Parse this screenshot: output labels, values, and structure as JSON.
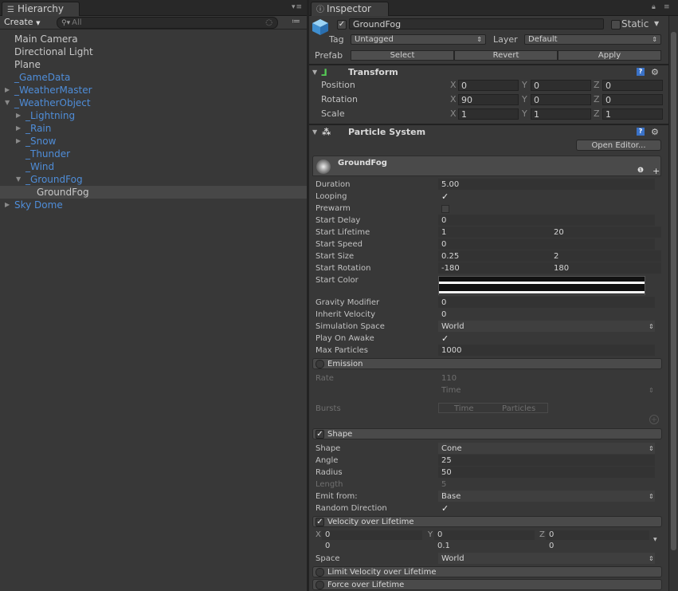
{
  "hierarchy": {
    "tab_label": "Hierarchy",
    "create_label": "Create",
    "search_placeholder": "All",
    "items": [
      {
        "label": "Main Camera"
      },
      {
        "label": "Directional Light"
      },
      {
        "label": "Plane"
      },
      {
        "label": "_GameData"
      },
      {
        "label": "_WeatherMaster"
      },
      {
        "label": "_WeatherObject"
      },
      {
        "label": "_Lightning"
      },
      {
        "label": "_Rain"
      },
      {
        "label": "_Snow"
      },
      {
        "label": "_Thunder"
      },
      {
        "label": "_Wind"
      },
      {
        "label": "_GroundFog"
      },
      {
        "label": "GroundFog"
      },
      {
        "label": "Sky Dome"
      }
    ]
  },
  "inspector": {
    "tab_label": "Inspector",
    "object_name": "GroundFog",
    "static_label": "Static",
    "tag_label": "Tag",
    "tag_value": "Untagged",
    "layer_label": "Layer",
    "layer_value": "Default",
    "prefab_label": "Prefab",
    "prefab_buttons": [
      "Select",
      "Revert",
      "Apply"
    ],
    "transform": {
      "title": "Transform",
      "rows": [
        {
          "label": "Position",
          "x": "0",
          "y": "0",
          "z": "0"
        },
        {
          "label": "Rotation",
          "x": "90",
          "y": "0",
          "z": "0"
        },
        {
          "label": "Scale",
          "x": "1",
          "y": "1",
          "z": "1"
        }
      ],
      "axis_x": "X",
      "axis_y": "Y",
      "axis_z": "Z"
    },
    "particle_system": {
      "title": "Particle System",
      "open_editor": "Open Editor...",
      "system_name": "GroundFog",
      "main": {
        "duration_label": "Duration",
        "duration": "5.00",
        "looping_label": "Looping",
        "prewarm_label": "Prewarm",
        "start_delay_label": "Start Delay",
        "start_delay": "0",
        "start_lifetime_label": "Start Lifetime",
        "start_lifetime_min": "1",
        "start_lifetime_max": "20",
        "start_speed_label": "Start Speed",
        "start_speed": "0",
        "start_size_label": "Start Size",
        "start_size_min": "0.25",
        "start_size_max": "2",
        "start_rotation_label": "Start Rotation",
        "start_rotation_min": "-180",
        "start_rotation_max": "180",
        "start_color_label": "Start Color",
        "gravity_label": "Gravity Modifier",
        "gravity": "0",
        "inherit_label": "Inherit Velocity",
        "inherit": "0",
        "sim_space_label": "Simulation Space",
        "sim_space": "World",
        "play_on_awake_label": "Play On Awake",
        "max_particles_label": "Max Particles",
        "max_particles": "1000"
      },
      "emission": {
        "title": "Emission",
        "rate_label": "Rate",
        "rate": "110",
        "rate_mode": "Time",
        "bursts_label": "Bursts",
        "bursts_col_time": "Time",
        "bursts_col_particles": "Particles"
      },
      "shape": {
        "title": "Shape",
        "shape_label": "Shape",
        "shape": "Cone",
        "angle_label": "Angle",
        "angle": "25",
        "radius_label": "Radius",
        "radius": "50",
        "length_label": "Length",
        "length": "5",
        "emit_from_label": "Emit from:",
        "emit_from": "Base",
        "random_dir_label": "Random Direction"
      },
      "velocity": {
        "title": "Velocity over Lifetime",
        "x_label": "X",
        "x_top": "0",
        "x_bottom": "0",
        "y_label": "Y",
        "y_top": "0",
        "y_bottom": "0.1",
        "z_label": "Z",
        "z_top": "0",
        "z_bottom": "0",
        "space_label": "Space",
        "space": "World"
      },
      "limit_velocity_title": "Limit Velocity over Lifetime",
      "force_title": "Force over Lifetime"
    }
  },
  "colors": {
    "blue_text": "#4f8dd8",
    "panel_bg": "#383838",
    "selected_row": "#474747"
  },
  "icons": [
    "list-icon",
    "info-icon",
    "lock-icon",
    "menu-icon",
    "search-icon",
    "filter-icon",
    "cube-icon",
    "transform-axes-icon",
    "help-icon",
    "gear-icon",
    "particle-icon",
    "checkmark-icon",
    "dropdown-arrow-icon",
    "add-icon"
  ]
}
